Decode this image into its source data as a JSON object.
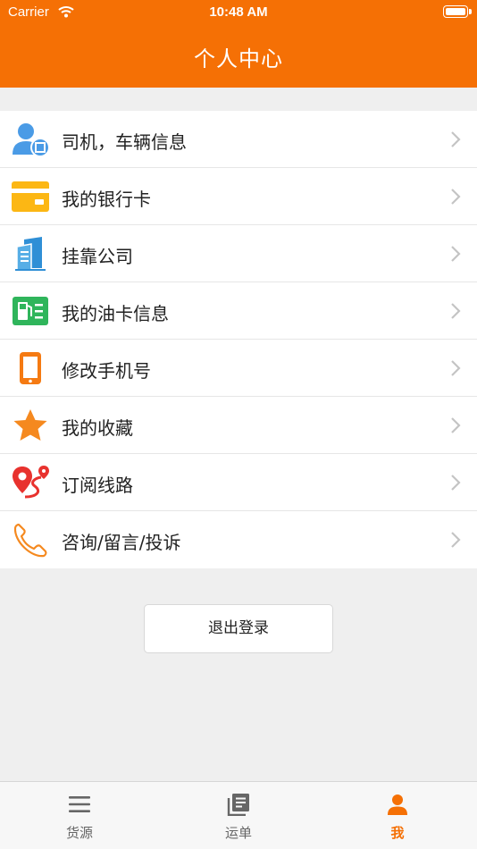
{
  "status_bar": {
    "carrier": "Carrier",
    "time": "10:48 AM"
  },
  "header": {
    "title": "个人中心"
  },
  "menu": {
    "items": [
      {
        "label": "司机，车辆信息",
        "icon": "driver-id-icon"
      },
      {
        "label": "我的银行卡",
        "icon": "bank-card-icon"
      },
      {
        "label": "挂靠公司",
        "icon": "company-building-icon"
      },
      {
        "label": "我的油卡信息",
        "icon": "fuel-card-icon"
      },
      {
        "label": "修改手机号",
        "icon": "phone-device-icon"
      },
      {
        "label": "我的收藏",
        "icon": "star-icon"
      },
      {
        "label": "订阅线路",
        "icon": "route-pin-icon"
      },
      {
        "label": "咨询/留言/投诉",
        "icon": "telephone-icon"
      }
    ]
  },
  "logout": {
    "label": "退出登录"
  },
  "tabbar": {
    "tabs": [
      {
        "label": "货源",
        "icon": "list-icon",
        "active": false
      },
      {
        "label": "运单",
        "icon": "waybill-icon",
        "active": false
      },
      {
        "label": "我",
        "icon": "person-icon",
        "active": true
      }
    ]
  },
  "colors": {
    "brand": "#f57005",
    "background": "#efefef",
    "tab_inactive": "#666666"
  }
}
